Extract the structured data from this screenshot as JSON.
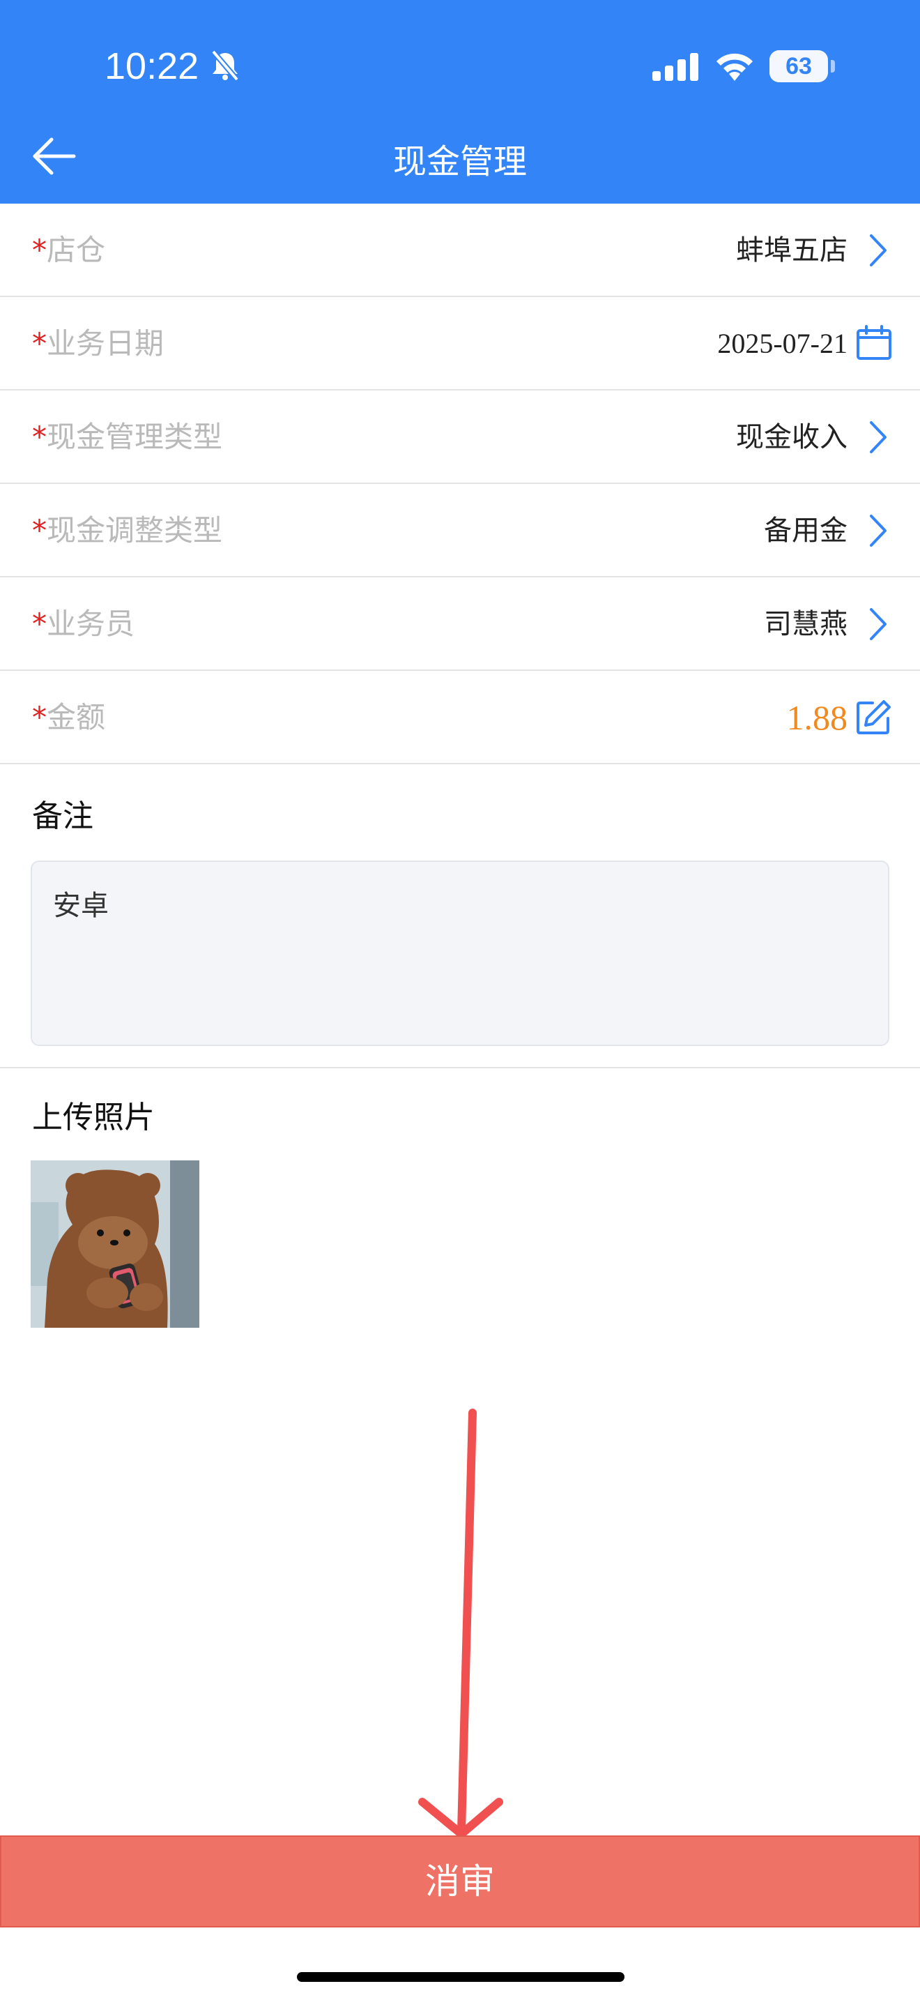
{
  "status_bar": {
    "time": "10:22",
    "battery": "63",
    "battery_level": 0.63
  },
  "header": {
    "title": "现金管理"
  },
  "form": {
    "required_mark": "*",
    "rows": [
      {
        "label": "店仓",
        "value": "蚌埠五店",
        "icon": "chevron-right-icon"
      },
      {
        "label": "业务日期",
        "value": "2025-07-21",
        "icon": "calendar-icon"
      },
      {
        "label": "现金管理类型",
        "value": "现金收入",
        "icon": "chevron-right-icon"
      },
      {
        "label": "现金调整类型",
        "value": "备用金",
        "icon": "chevron-right-icon"
      },
      {
        "label": "业务员",
        "value": "司慧燕",
        "icon": "chevron-right-icon"
      },
      {
        "label": "金额",
        "value": "1.88",
        "icon": "edit-icon"
      }
    ]
  },
  "remark": {
    "title": "备注",
    "text": "安卓"
  },
  "upload": {
    "title": "上传照片"
  },
  "footer": {
    "button_label": "消审"
  },
  "colors": {
    "primary": "#3385f7",
    "danger_button": "#ee7265",
    "amount": "#f08a1e",
    "required": "#e02020",
    "annotation_arrow": "#f05050"
  }
}
